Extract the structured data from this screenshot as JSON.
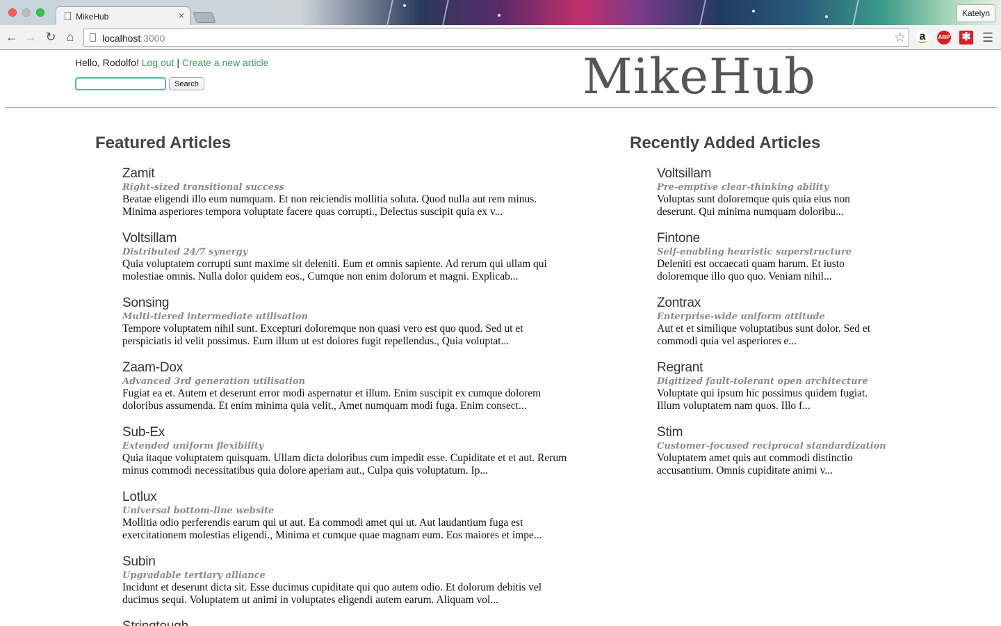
{
  "browser": {
    "tab_title": "MikeHub",
    "tab_close": "×",
    "profile_name": "Katelyn",
    "url_host": "localhost",
    "url_port": ":3000",
    "icons": [
      "back-arrow-icon",
      "forward-arrow-icon",
      "reload-icon",
      "home-icon",
      "bookmark-star-icon",
      "amazon-icon",
      "adblock-plus-icon",
      "lastpass-icon",
      "menu-icon"
    ]
  },
  "header": {
    "greeting": "Hello, Rodolfo!",
    "logout_label": "Log out",
    "separator": "|",
    "create_label": "Create a new article",
    "search_placeholder": "",
    "search_value": "",
    "search_button": "Search",
    "brand": "MikeHub"
  },
  "featured": {
    "heading": "Featured Articles",
    "articles": [
      {
        "title": "Zamit",
        "tagline": "Right-sized transitional success",
        "line1": "Beatae eligendi illo eum numquam. Et non reiciendis mollitia soluta. Quod nulla aut rem minus.",
        "line2": "Minima asperiores tempora voluptate facere quas corrupti., Delectus suscipit quia ex v..."
      },
      {
        "title": "Voltsillam",
        "tagline": "Distributed 24/7 synergy",
        "line1": "Quia voluptatem corrupti sunt maxime sit deleniti. Eum et omnis sapiente. Ad rerum qui ullam qui",
        "line2": "molestiae omnis. Nulla dolor quidem eos., Cumque non enim dolorum et magni. Explicab..."
      },
      {
        "title": "Sonsing",
        "tagline": "Multi-tiered intermediate utilisation",
        "line1": "Tempore voluptatem nihil sunt. Excepturi doloremque non quasi vero est quo quod. Sed ut et",
        "line2": "perspiciatis id velit possimus. Eum illum ut est dolores fugit repellendus., Quia voluptat..."
      },
      {
        "title": "Zaam-Dox",
        "tagline": "Advanced 3rd generation utilisation",
        "line1": "Fugiat ea et. Autem et deserunt error modi aspernatur et illum. Enim suscipit ex cumque dolorem",
        "line2": "doloribus assumenda. Et enim minima quia velit., Amet numquam modi fuga. Enim consect..."
      },
      {
        "title": "Sub-Ex",
        "tagline": "Extended uniform flexibility",
        "line1": "Quia itaque voluptatem quisquam. Ullam dicta doloribus cum impedit esse. Cupiditate et et aut. Rerum",
        "line2": "minus commodi necessitatibus quia dolore aperiam aut., Culpa quis voluptatum. Ip..."
      },
      {
        "title": "Lotlux",
        "tagline": "Universal bottom-line website",
        "line1": "Mollitia odio perferendis earum qui ut aut. Ea commodi amet qui ut. Aut laudantium fuga est",
        "line2": "exercitationem molestias eligendi., Minima et cumque quae magnam eum. Eos maiores et impe..."
      },
      {
        "title": "Subin",
        "tagline": "Upgradable tertiary alliance",
        "line1": "Incidunt et deserunt dicta sit. Esse ducimus cupiditate qui quo autem odio. Et dolorum debitis vel",
        "line2": "ducimus sequi. Voluptatem ut animi in voluptates eligendi autem earum. Aliquam vol..."
      },
      {
        "title": "Stringtough",
        "tagline": "",
        "line1": "",
        "line2": ""
      }
    ]
  },
  "recent": {
    "heading": "Recently Added Articles",
    "articles": [
      {
        "title": "Voltsillam",
        "tagline": "Pre-emptive clear-thinking ability",
        "line1": "Voluptas sunt doloremque quis quia eius non",
        "line2": "deserunt. Qui minima numquam doloribu..."
      },
      {
        "title": "Fintone",
        "tagline": "Self-enabling heuristic superstructure",
        "line1": "Deleniti est occaecati quam harum. Et iusto",
        "line2": "doloremque illo quo quo. Veniam nihil..."
      },
      {
        "title": "Zontrax",
        "tagline": "Enterprise-wide uniform attitude",
        "line1": "Aut et et similique voluptatibus sunt dolor. Sed et",
        "line2": "commodi quia vel asperiores e..."
      },
      {
        "title": "Regrant",
        "tagline": "Digitized fault-tolerant open architecture",
        "line1": "Voluptate qui ipsum hic possimus quidem fugiat.",
        "line2": "Illum voluptatem nam quos. Illo f..."
      },
      {
        "title": "Stim",
        "tagline": "Customer-focused reciprocal standardization",
        "line1": "Voluptatem amet quis aut commodi distinctio",
        "line2": "accusantium. Omnis cupiditate animi v..."
      }
    ]
  }
}
